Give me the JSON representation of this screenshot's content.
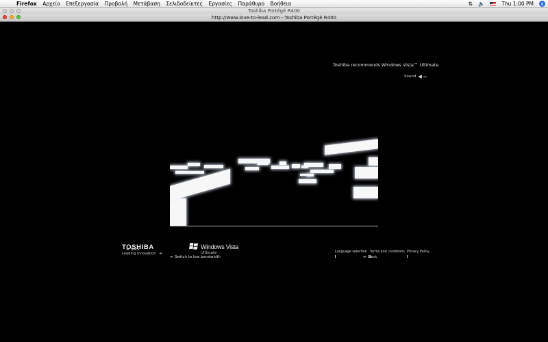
{
  "menubar": {
    "app": "Firefox",
    "items": [
      "Αρχείο",
      "Επεξεργασία",
      "Προβολή",
      "Μετάβαση",
      "Σελιδοδείκτες",
      "Εργασίες",
      "Παράθυρο",
      "Βοήθεια"
    ],
    "clock": "Thu 1:00 PM"
  },
  "window": {
    "title": "Toshiba Portégé R400",
    "tab_title": "http://www.love-to-lead.com - Toshiba Portégé R400"
  },
  "page": {
    "recommend": "Toshiba recommends Windows Vista™ Ultimate",
    "sound_label": "Sound",
    "back_left": "Back",
    "switch_bandwidth": "Switch to low bandwidth",
    "back_right": "Back",
    "brand": "TOSHIBA",
    "tagline": "Leading Innovation",
    "vista_name": "Windows Vista",
    "vista_edition": "Ultimate",
    "footer_links": [
      "Language selection",
      "Terms and conditions",
      "Privacy Policy"
    ]
  },
  "icons": [
    "apple-icon",
    "sync-icon",
    "volume-icon",
    "flag-icon",
    "spotlight-icon",
    "speaker-icon",
    "windows-flag-icon"
  ]
}
